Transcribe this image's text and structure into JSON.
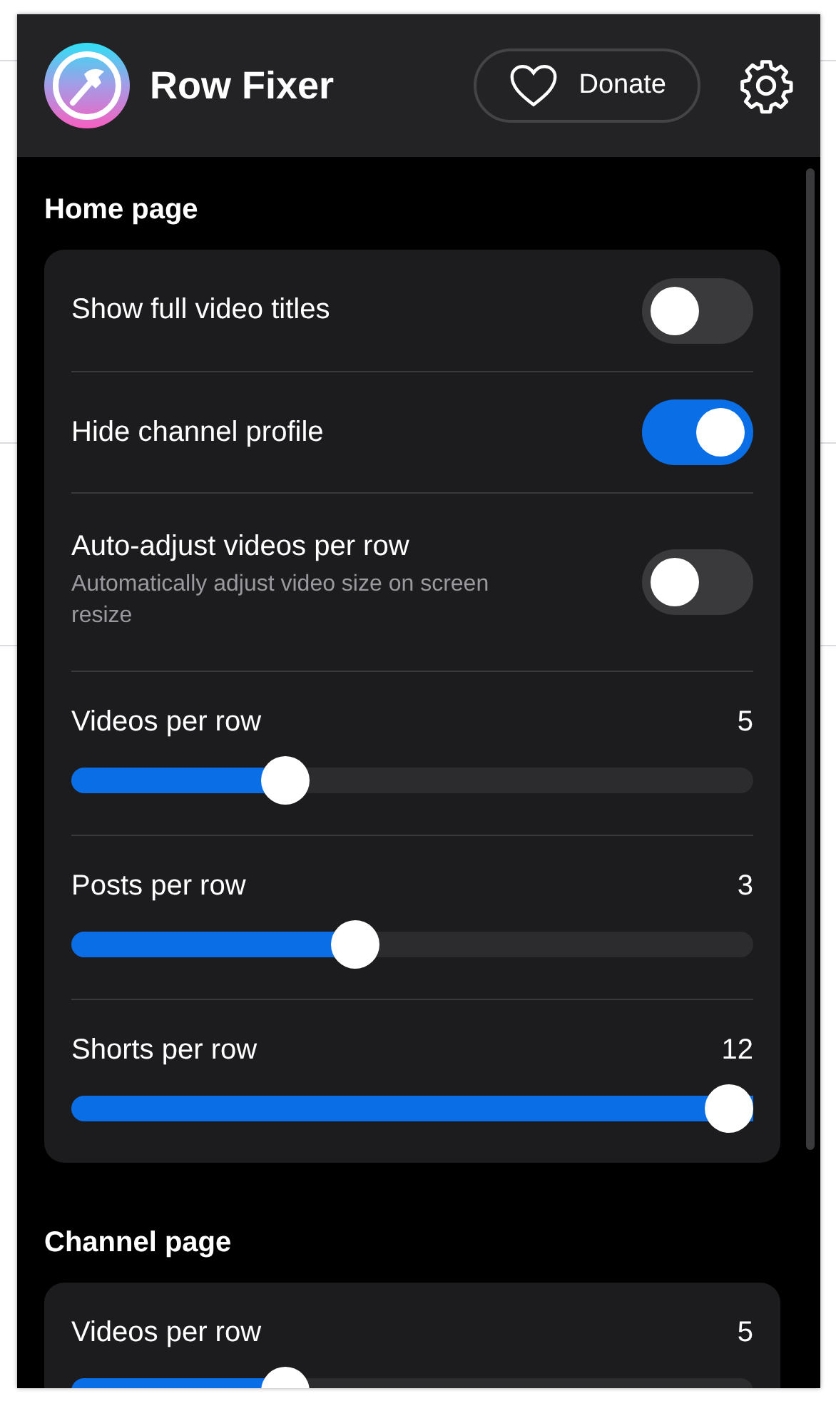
{
  "header": {
    "title": "Row Fixer",
    "donate_label": "Donate"
  },
  "sections": [
    {
      "title": "Home page",
      "items": [
        {
          "kind": "toggle",
          "label": "Show full video titles",
          "on": false
        },
        {
          "kind": "toggle",
          "label": "Hide channel profile",
          "on": true
        },
        {
          "kind": "toggle",
          "label": "Auto-adjust videos per row",
          "description": "Automatically adjust video size on screen resize",
          "on": false
        },
        {
          "kind": "slider",
          "label": "Videos per row",
          "value": "5",
          "level": 0.3
        },
        {
          "kind": "slider",
          "label": "Posts per row",
          "value": "3",
          "level": 0.41
        },
        {
          "kind": "slider",
          "label": "Shorts per row",
          "value": "12",
          "level": 1
        }
      ]
    },
    {
      "title": "Channel page",
      "items": [
        {
          "kind": "slider",
          "label": "Videos per row",
          "value": "5",
          "level": 0.3
        }
      ]
    }
  ]
}
